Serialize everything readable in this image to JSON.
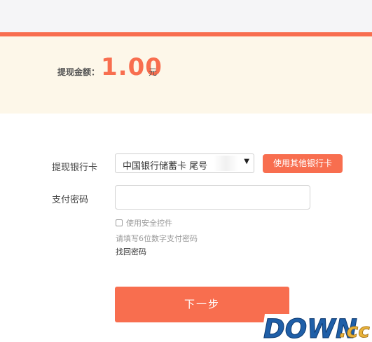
{
  "amount": {
    "label": "提现金额：",
    "value": "1.00",
    "unit": "元"
  },
  "bank": {
    "label": "提现银行卡",
    "selected_value": "中国银行储蓄卡 尾号",
    "other_button": "使用其他银行卡"
  },
  "password": {
    "label": "支付密码",
    "value": "",
    "secure_control": "使用安全控件",
    "hint": "请填写6位数字支付密码",
    "retrieve_link": "找回密码"
  },
  "next_button": "下一步",
  "watermark": {
    "text_main": "DOWN",
    "text_suffix": ".cc"
  },
  "colors": {
    "accent": "#f86e4f",
    "panel_bg": "#fdf7e9",
    "topbar_bg": "#f5f5f7"
  }
}
